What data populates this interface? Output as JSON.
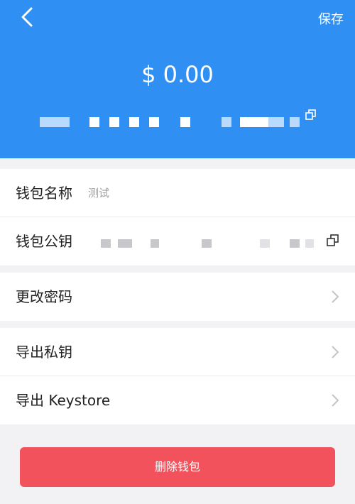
{
  "header": {
    "save_label": "保存",
    "balance": "$ 0.00"
  },
  "wallet_name": {
    "label": "钱包名称",
    "value": "测试"
  },
  "public_key": {
    "label": "钱包公钥"
  },
  "menu": {
    "change_password": "更改密码",
    "export_private_key": "导出私钥",
    "export_keystore": "导出 Keystore"
  },
  "delete_button": "删除钱包",
  "colors": {
    "header_bg": "#2f8ff2",
    "danger": "#f2525c",
    "page_bg": "#f2f2f4"
  },
  "icons": [
    "back-arrow-icon",
    "copy-icon",
    "chevron-right-icon"
  ]
}
